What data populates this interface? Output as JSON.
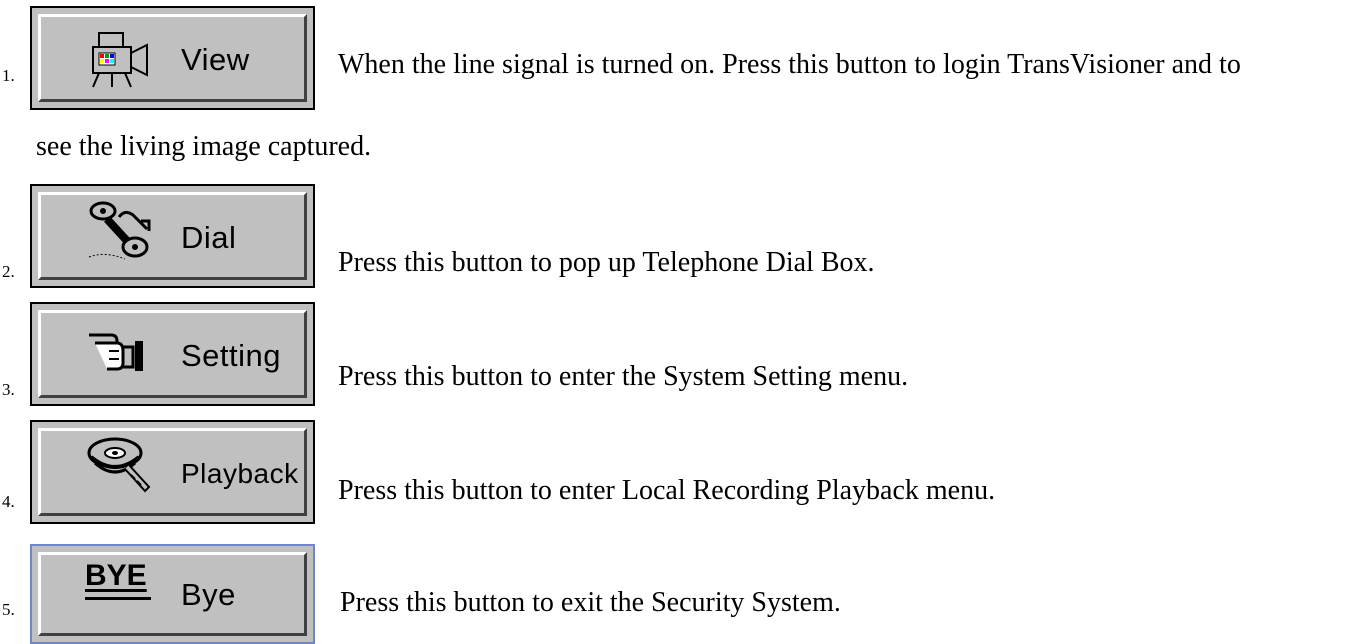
{
  "items": [
    {
      "number": "1.",
      "button_label": "View",
      "icon": "video-camera-icon",
      "description": "When the line signal is turned on. Press this button to login TransVisioner and to",
      "description_cont": "see the living image captured."
    },
    {
      "number": "2.",
      "button_label": "Dial",
      "icon": "telephone-handset-icon",
      "description": "Press this button to pop up Telephone Dial Box."
    },
    {
      "number": "3.",
      "button_label": "Setting",
      "icon": "pointing-hand-icon",
      "description": "Press this button to enter the System Setting menu."
    },
    {
      "number": "4.",
      "button_label": "Playback",
      "icon": "film-reel-icon",
      "description": "Press this button to enter Local Recording Playback menu."
    },
    {
      "number": "5.",
      "button_label": "Bye",
      "icon": "bye-icon",
      "icon_text": "BYE",
      "description": "Press this button to exit the Security System."
    }
  ]
}
